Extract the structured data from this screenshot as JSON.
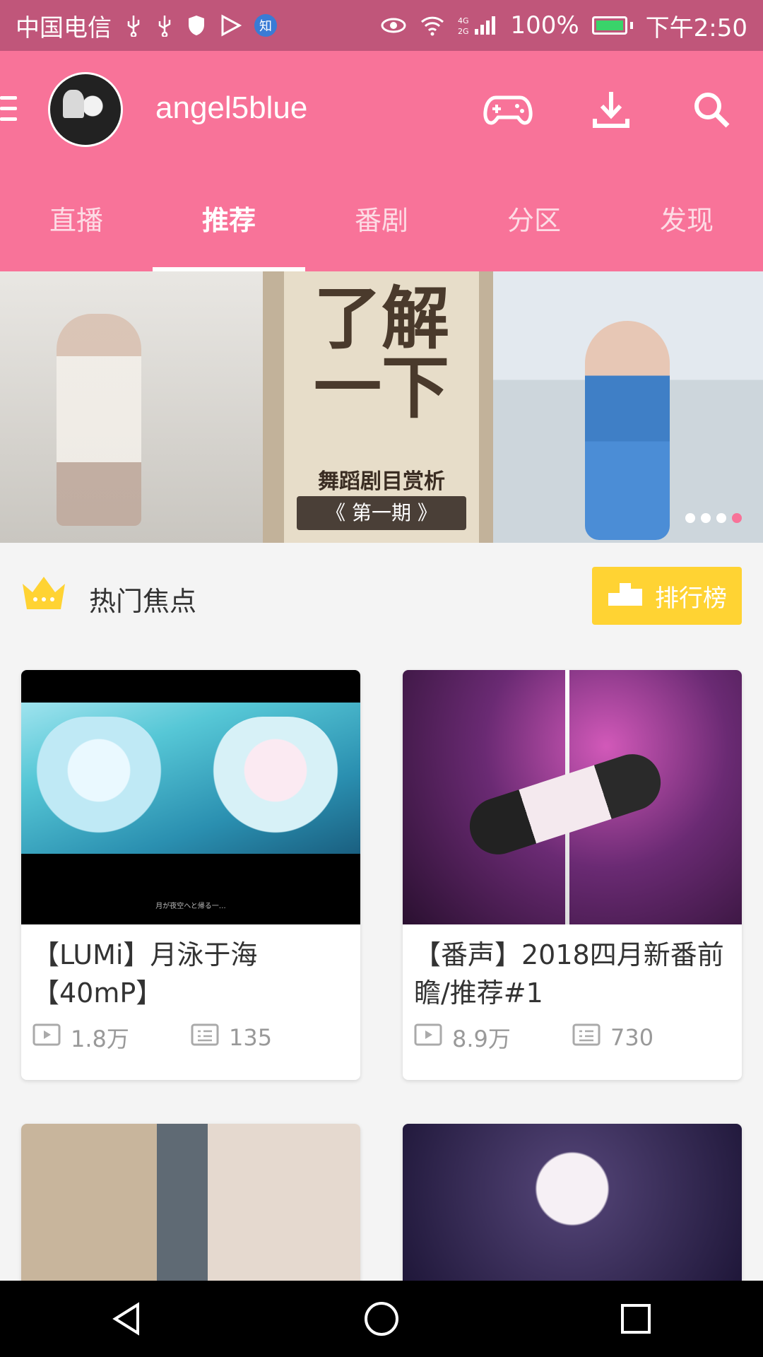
{
  "status_bar": {
    "carrier": "中国电信",
    "zhi_badge": "知",
    "network": "4G 2G",
    "battery_percent": "100%",
    "time": "下午2:50"
  },
  "header": {
    "username": "angel5blue",
    "icons": [
      "menu-icon",
      "gamepad-icon",
      "download-icon",
      "search-icon"
    ],
    "accent_color": "#f87399"
  },
  "tabs": [
    {
      "label": "直播"
    },
    {
      "label": "推荐",
      "active": true
    },
    {
      "label": "番剧"
    },
    {
      "label": "分区"
    },
    {
      "label": "发现"
    }
  ],
  "banner": {
    "title_line1": "了解",
    "title_line2": "一下",
    "subtitle": "舞蹈剧目赏析",
    "episode": "《 第一期 》",
    "page_count": 4,
    "active_page": 4
  },
  "section": {
    "title": "热门焦点",
    "rank_label": "排行榜"
  },
  "cards": [
    {
      "title": "【LUMi】月泳于海【40mP】",
      "views": "1.8万",
      "danmaku": "135",
      "thumb_caption": "月が夜空へと帰る一…"
    },
    {
      "title": "【番声】2018四月新番前瞻/推荐#1",
      "views": "8.9万",
      "danmaku": "730"
    }
  ]
}
